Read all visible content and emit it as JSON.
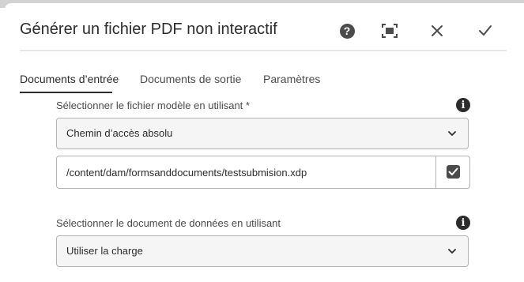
{
  "dialog": {
    "title": "Générer un fichier PDF non interactif",
    "toolbar": {
      "help_icon": "help-icon",
      "fullscreen_icon": "fit-to-screen-icon",
      "close_icon": "close-icon",
      "done_icon": "check-icon"
    }
  },
  "tabs": [
    {
      "label": "Documents d’entrée",
      "active": true
    },
    {
      "label": "Documents de sortie",
      "active": false
    },
    {
      "label": "Paramètres",
      "active": false
    }
  ],
  "template_field": {
    "label": "Sélectionner le fichier modèle en utilisant *",
    "info_icon": "info-icon",
    "select_value": "Chemin d’accès absolu",
    "path_value": "/content/dam/formsanddocuments/testsubmision.xdp",
    "checkbox_checked": true
  },
  "data_field": {
    "label": "Sélectionner le document de données en utilisant",
    "info_icon": "info-icon",
    "select_value": "Utiliser la charge"
  },
  "colors": {
    "accent": "#2c2c2c",
    "border": "#b3b3b3",
    "field_bg": "#f5f5f5"
  }
}
